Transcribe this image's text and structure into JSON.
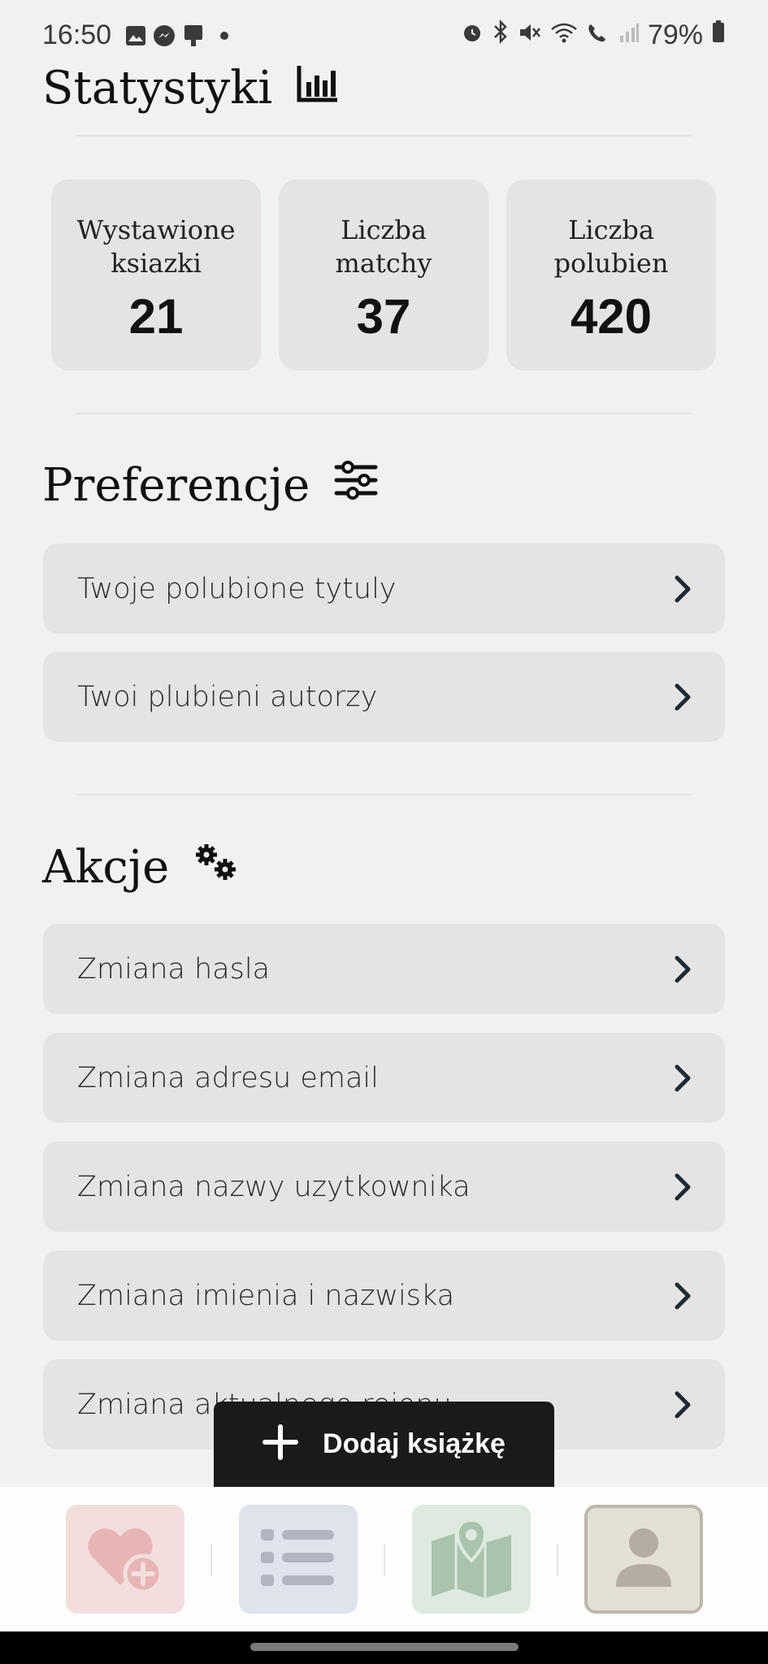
{
  "status_bar": {
    "time": "16:50",
    "battery": "79%",
    "left_icons": [
      "image-icon",
      "messenger-icon",
      "device-icon",
      "dot-icon"
    ],
    "right_icons": [
      "alarm-icon",
      "bluetooth-icon",
      "mute-icon",
      "wifi-icon",
      "wifi-call-icon",
      "signal-icon",
      "battery-icon"
    ]
  },
  "stats": {
    "title": "Statystyki",
    "icon": "bar-chart-icon",
    "cards": [
      {
        "label": "Wystawione\nksiazki",
        "value": "21"
      },
      {
        "label": "Liczba\nmatchy",
        "value": "37"
      },
      {
        "label": "Liczba\npolubien",
        "value": "420"
      }
    ]
  },
  "preferences": {
    "title": "Preferencje",
    "icon": "sliders-icon",
    "items": [
      "Twoje polubione tytuly",
      "Twoi plubieni autorzy"
    ]
  },
  "actions": {
    "title": "Akcje",
    "icon": "gears-icon",
    "items": [
      "Zmiana hasla",
      "Zmiana adresu email",
      "Zmiana nazwy uzytkownika",
      "Zmiana imienia i nazwiska",
      "Zmiana aktualnego rejonu"
    ]
  },
  "fab": {
    "label": "Dodaj książkę",
    "icon": "plus-icon"
  },
  "bottom_nav": {
    "items": [
      {
        "name": "like-add",
        "icon": "heart-plus-icon",
        "color": "#f3dede"
      },
      {
        "name": "list",
        "icon": "list-icon",
        "color": "#dfe3ec"
      },
      {
        "name": "map",
        "icon": "map-pin-icon",
        "color": "#deeadf"
      },
      {
        "name": "profile",
        "icon": "user-icon",
        "color": "#e3e0d5",
        "active": true
      }
    ]
  }
}
